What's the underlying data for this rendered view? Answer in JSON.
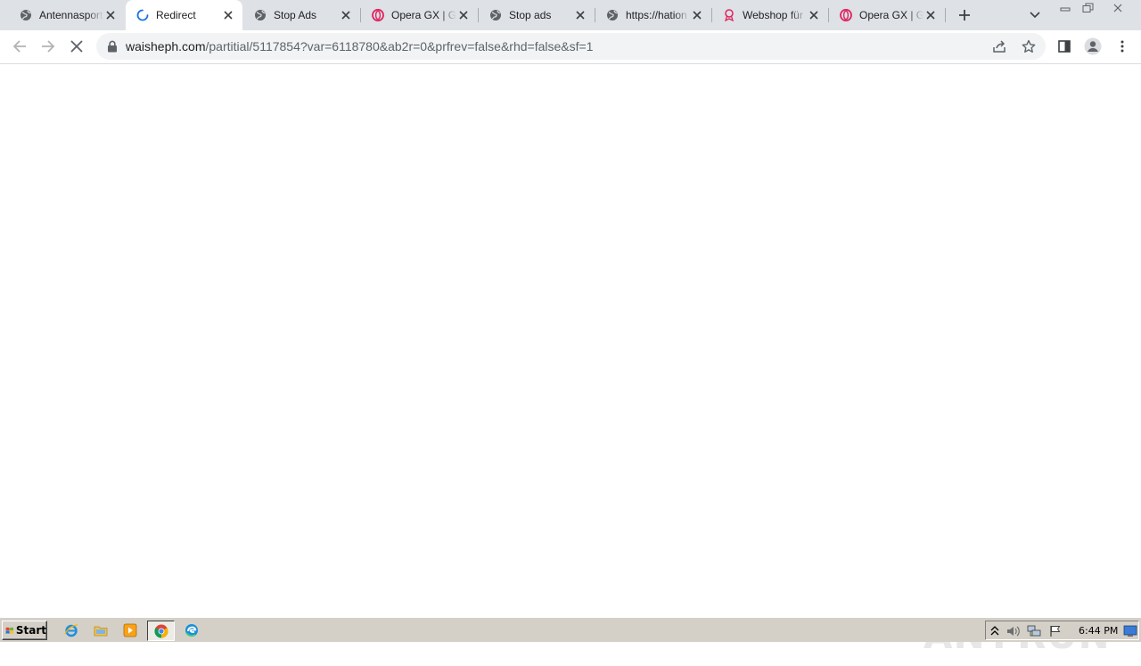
{
  "browser": {
    "tabs": [
      {
        "title": "Antennasport",
        "favicon": "globe-icon",
        "active": false
      },
      {
        "title": "Redirect",
        "favicon": "loading-spinner-icon",
        "active": true
      },
      {
        "title": "Stop Ads",
        "favicon": "globe-icon",
        "active": false
      },
      {
        "title": "Opera GX | Ga",
        "favicon": "opera-icon",
        "active": false
      },
      {
        "title": "Stop ads",
        "favicon": "globe-icon",
        "active": false
      },
      {
        "title": "https://hation",
        "favicon": "globe-icon",
        "active": false
      },
      {
        "title": "Webshop für",
        "favicon": "ribbon-icon",
        "active": false
      },
      {
        "title": "Opera GX | Ga",
        "favicon": "opera-icon",
        "active": false
      }
    ],
    "address_bar": {
      "host": "waisheph.com",
      "path": "/partitial/5117854?var=6118780&ab2r=0&prfrev=false&rhd=false&sf=1"
    },
    "colors": {
      "tabstrip_bg": "#dee1e6",
      "active_tab_bg": "#ffffff",
      "accent_blue": "#1a73e8",
      "opera_red": "#e0245e",
      "icon_gray": "#5f6368"
    }
  },
  "watermark": {
    "text_left": "ANY",
    "text_right": "RUN"
  },
  "taskbar": {
    "start_label": "Start",
    "clock": "6:44 PM",
    "quick_launch": [
      "internet-explorer-icon",
      "folder-icon",
      "media-player-icon",
      "chrome-icon",
      "edge-icon"
    ],
    "tray_icons": [
      "up-arrow-icon",
      "speaker-icon",
      "network-icon",
      "flag-icon"
    ]
  }
}
